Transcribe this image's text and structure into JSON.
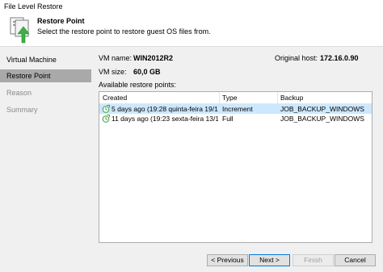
{
  "window": {
    "title": "File Level Restore"
  },
  "header": {
    "title": "Restore Point",
    "description": "Select the restore point to restore guest OS files from.",
    "icon": "restore-server-icon"
  },
  "sidebar": {
    "items": [
      {
        "label": "Virtual Machine",
        "state": "normal"
      },
      {
        "label": "Restore Point",
        "state": "active"
      },
      {
        "label": "Reason",
        "state": "disabled"
      },
      {
        "label": "Summary",
        "state": "disabled"
      }
    ]
  },
  "details": {
    "vm_name_label": "VM name:",
    "vm_name_value": "WIN2012R2",
    "original_host_label": "Original host:",
    "original_host_value": "172.16.0.90",
    "vm_size_label": "VM size:",
    "vm_size_value": "60,0 GB",
    "available_label": "Available restore points:"
  },
  "table": {
    "columns": [
      "Created",
      "Type",
      "Backup"
    ],
    "rows": [
      {
        "created": "5 days ago (19:28 quinta-feira 19/10/2...",
        "type": "Increment",
        "backup": "JOB_BACKUP_WINDOWS",
        "selected": true
      },
      {
        "created": "11 days ago (19:23 sexta-feira 13/10/2...",
        "type": "Full",
        "backup": "JOB_BACKUP_WINDOWS",
        "selected": false
      }
    ]
  },
  "buttons": {
    "previous": "< Previous",
    "next": "Next >",
    "finish": "Finish",
    "cancel": "Cancel"
  },
  "colors": {
    "accent": "#0078d7",
    "selected_row": "#cce8ff",
    "active_nav": "#a9a9a9"
  }
}
